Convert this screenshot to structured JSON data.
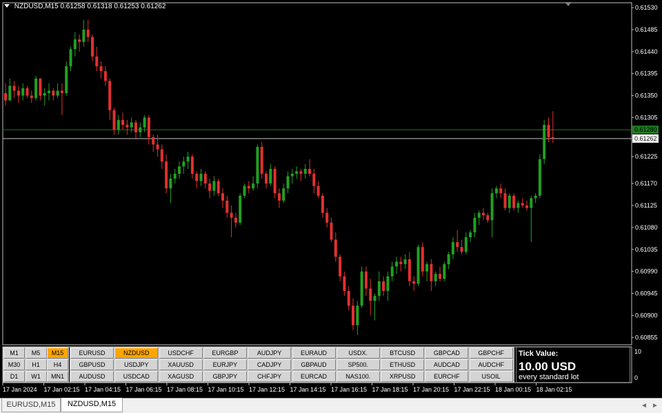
{
  "title": {
    "symbol_tf": "NZDUSD,M15",
    "ohlc": "0.61258 0.61318 0.61253 0.61262"
  },
  "colors": {
    "background": "#000000",
    "bull": "#22a022",
    "bear": "#e23030",
    "axis_text": "#ffffff",
    "ask_line": "#1f7a1f",
    "bid_line": "#c8c8c8",
    "active_button": "#ffa500"
  },
  "price_axis": {
    "labels": [
      "0.61530",
      "0.61485",
      "0.61440",
      "0.61395",
      "0.61350",
      "0.61305",
      "0.61262",
      "0.61225",
      "0.61170",
      "0.61125",
      "0.61080",
      "0.61035",
      "0.60990",
      "0.60945",
      "0.60900",
      "0.60855"
    ],
    "ask_price": "0.61280",
    "bid_price": "0.61262",
    "ylim": [
      0.6084,
      0.6154
    ]
  },
  "time_axis": {
    "labels": [
      "17 Jan 2024",
      "17 Jan 02:15",
      "17 Jan 04:15",
      "17 Jan 06:15",
      "17 Jan 08:15",
      "17 Jan 10:15",
      "17 Jan 12:15",
      "17 Jan 14:15",
      "17 Jan 16:15",
      "17 Jan 18:15",
      "17 Jan 20:15",
      "17 Jan 22:15",
      "18 Jan 00:15",
      "18 Jan 02:15"
    ]
  },
  "chart_data": {
    "type": "candlestick",
    "symbol": "NZDUSD",
    "timeframe": "M15",
    "ylim": [
      0.6084,
      0.6154
    ],
    "candles": [
      [
        0.61355,
        0.61375,
        0.6133,
        0.6134
      ],
      [
        0.6134,
        0.61385,
        0.6134,
        0.6137
      ],
      [
        0.6137,
        0.6138,
        0.61345,
        0.6136
      ],
      [
        0.6136,
        0.6137,
        0.61335,
        0.6135
      ],
      [
        0.6135,
        0.61375,
        0.6134,
        0.61365
      ],
      [
        0.61365,
        0.6137,
        0.61345,
        0.6135
      ],
      [
        0.6135,
        0.6136,
        0.61335,
        0.61345
      ],
      [
        0.61345,
        0.6139,
        0.6134,
        0.61385
      ],
      [
        0.61385,
        0.61385,
        0.6134,
        0.6135
      ],
      [
        0.6135,
        0.61365,
        0.6133,
        0.61355
      ],
      [
        0.61355,
        0.61375,
        0.6134,
        0.6136
      ],
      [
        0.6136,
        0.61365,
        0.6134,
        0.6135
      ],
      [
        0.6135,
        0.61375,
        0.61345,
        0.6136
      ],
      [
        0.6136,
        0.61375,
        0.6131,
        0.61355
      ],
      [
        0.61355,
        0.6142,
        0.6135,
        0.6141
      ],
      [
        0.6141,
        0.6145,
        0.614,
        0.61445
      ],
      [
        0.61445,
        0.6148,
        0.6143,
        0.61465
      ],
      [
        0.61465,
        0.61475,
        0.6144,
        0.6146
      ],
      [
        0.6146,
        0.61505,
        0.6145,
        0.61485
      ],
      [
        0.61485,
        0.61505,
        0.6146,
        0.6147
      ],
      [
        0.6147,
        0.61475,
        0.6142,
        0.6143
      ],
      [
        0.6143,
        0.6145,
        0.614,
        0.6141
      ],
      [
        0.6141,
        0.6142,
        0.61385,
        0.614
      ],
      [
        0.614,
        0.6141,
        0.6137,
        0.6138
      ],
      [
        0.6138,
        0.61385,
        0.613,
        0.6132
      ],
      [
        0.6132,
        0.61325,
        0.6127,
        0.6128
      ],
      [
        0.6128,
        0.6131,
        0.6127,
        0.613
      ],
      [
        0.613,
        0.61315,
        0.6128,
        0.6129
      ],
      [
        0.6129,
        0.613,
        0.6127,
        0.61285
      ],
      [
        0.61285,
        0.61305,
        0.61275,
        0.61295
      ],
      [
        0.61295,
        0.613,
        0.6126,
        0.61275
      ],
      [
        0.61275,
        0.61295,
        0.61265,
        0.61285
      ],
      [
        0.61285,
        0.6131,
        0.61275,
        0.61305
      ],
      [
        0.61305,
        0.6131,
        0.6125,
        0.61265
      ],
      [
        0.61265,
        0.6127,
        0.61235,
        0.6125
      ],
      [
        0.6125,
        0.6127,
        0.61225,
        0.6124
      ],
      [
        0.6124,
        0.6125,
        0.612,
        0.61215
      ],
      [
        0.61215,
        0.6123,
        0.6115,
        0.6116
      ],
      [
        0.6116,
        0.6119,
        0.6113,
        0.6118
      ],
      [
        0.6118,
        0.612,
        0.6117,
        0.6119
      ],
      [
        0.6119,
        0.61215,
        0.6118,
        0.61205
      ],
      [
        0.61205,
        0.61225,
        0.6119,
        0.61215
      ],
      [
        0.61215,
        0.61235,
        0.612,
        0.61225
      ],
      [
        0.61225,
        0.6123,
        0.6118,
        0.6119
      ],
      [
        0.6119,
        0.61195,
        0.6116,
        0.61175
      ],
      [
        0.61175,
        0.612,
        0.61165,
        0.6119
      ],
      [
        0.6119,
        0.61195,
        0.6116,
        0.6117
      ],
      [
        0.6117,
        0.6118,
        0.6114,
        0.61155
      ],
      [
        0.61155,
        0.61185,
        0.61145,
        0.61175
      ],
      [
        0.61175,
        0.6118,
        0.61145,
        0.6115
      ],
      [
        0.6115,
        0.6116,
        0.6112,
        0.61135
      ],
      [
        0.61135,
        0.61145,
        0.611,
        0.6111
      ],
      [
        0.6111,
        0.61125,
        0.6106,
        0.611
      ],
      [
        0.611,
        0.6111,
        0.6108,
        0.6109
      ],
      [
        0.6109,
        0.6115,
        0.61085,
        0.61145
      ],
      [
        0.61145,
        0.6117,
        0.6114,
        0.61165
      ],
      [
        0.61165,
        0.61175,
        0.6115,
        0.6116
      ],
      [
        0.6116,
        0.61185,
        0.61155,
        0.6117
      ],
      [
        0.6117,
        0.6125,
        0.6116,
        0.61245
      ],
      [
        0.61245,
        0.61255,
        0.6118,
        0.6119
      ],
      [
        0.6119,
        0.61195,
        0.6116,
        0.6117
      ],
      [
        0.6117,
        0.6121,
        0.61165,
        0.612
      ],
      [
        0.612,
        0.61205,
        0.6114,
        0.6115
      ],
      [
        0.6115,
        0.6116,
        0.6112,
        0.61135
      ],
      [
        0.61135,
        0.6117,
        0.6113,
        0.6116
      ],
      [
        0.6116,
        0.61195,
        0.6115,
        0.61185
      ],
      [
        0.61185,
        0.612,
        0.6117,
        0.6119
      ],
      [
        0.6119,
        0.61205,
        0.6118,
        0.61195
      ],
      [
        0.61195,
        0.612,
        0.61175,
        0.6119
      ],
      [
        0.6119,
        0.6121,
        0.6118,
        0.612
      ],
      [
        0.612,
        0.6122,
        0.61185,
        0.6119
      ],
      [
        0.6119,
        0.612,
        0.6115,
        0.61165
      ],
      [
        0.61165,
        0.61175,
        0.6114,
        0.61145
      ],
      [
        0.61145,
        0.6115,
        0.611,
        0.6111
      ],
      [
        0.6111,
        0.6112,
        0.6108,
        0.6109
      ],
      [
        0.6109,
        0.611,
        0.6105,
        0.61055
      ],
      [
        0.61055,
        0.6107,
        0.6101,
        0.6102
      ],
      [
        0.6102,
        0.61025,
        0.6097,
        0.6098
      ],
      [
        0.6098,
        0.6099,
        0.6094,
        0.6095
      ],
      [
        0.6095,
        0.6096,
        0.6091,
        0.6092
      ],
      [
        0.6092,
        0.60935,
        0.6087,
        0.6088
      ],
      [
        0.6088,
        0.6093,
        0.6086,
        0.6092
      ],
      [
        0.6092,
        0.61,
        0.60915,
        0.6099
      ],
      [
        0.6099,
        0.61,
        0.6094,
        0.60955
      ],
      [
        0.60955,
        0.60975,
        0.609,
        0.6093
      ],
      [
        0.6093,
        0.60945,
        0.6089,
        0.6094
      ],
      [
        0.6094,
        0.6099,
        0.6093,
        0.6097
      ],
      [
        0.6097,
        0.6098,
        0.6094,
        0.6095
      ],
      [
        0.6095,
        0.6099,
        0.6093,
        0.6098
      ],
      [
        0.6098,
        0.6101,
        0.6097,
        0.61
      ],
      [
        0.61,
        0.6102,
        0.60985,
        0.6101
      ],
      [
        0.6101,
        0.6102,
        0.6099,
        0.61005
      ],
      [
        0.61005,
        0.61025,
        0.60995,
        0.61015
      ],
      [
        0.61015,
        0.6103,
        0.6096,
        0.6097
      ],
      [
        0.6097,
        0.6098,
        0.6095,
        0.60965
      ],
      [
        0.60965,
        0.61045,
        0.6096,
        0.6104
      ],
      [
        0.6104,
        0.6105,
        0.6098,
        0.6099
      ],
      [
        0.6099,
        0.6101,
        0.6097,
        0.61005
      ],
      [
        0.61005,
        0.61015,
        0.6095,
        0.6097
      ],
      [
        0.6097,
        0.6099,
        0.6096,
        0.60985
      ],
      [
        0.60985,
        0.61,
        0.6097,
        0.60975
      ],
      [
        0.60975,
        0.6101,
        0.6097,
        0.61005
      ],
      [
        0.61005,
        0.6103,
        0.60995,
        0.61025
      ],
      [
        0.61025,
        0.6106,
        0.61015,
        0.6105
      ],
      [
        0.6105,
        0.61075,
        0.6103,
        0.6104
      ],
      [
        0.6104,
        0.61055,
        0.61025,
        0.6103
      ],
      [
        0.6103,
        0.6107,
        0.61025,
        0.6106
      ],
      [
        0.6106,
        0.61075,
        0.6105,
        0.6107
      ],
      [
        0.6107,
        0.6111,
        0.6106,
        0.611
      ],
      [
        0.611,
        0.61115,
        0.61085,
        0.6111
      ],
      [
        0.6111,
        0.6112,
        0.61095,
        0.61105
      ],
      [
        0.61105,
        0.6111,
        0.6109,
        0.61095
      ],
      [
        0.61095,
        0.6116,
        0.6106,
        0.6115
      ],
      [
        0.6115,
        0.61165,
        0.6114,
        0.6116
      ],
      [
        0.6116,
        0.6117,
        0.6114,
        0.6115
      ],
      [
        0.6115,
        0.6116,
        0.61115,
        0.6112
      ],
      [
        0.6112,
        0.6115,
        0.6111,
        0.61145
      ],
      [
        0.61145,
        0.6115,
        0.61115,
        0.6112
      ],
      [
        0.6112,
        0.61135,
        0.6111,
        0.6113
      ],
      [
        0.6113,
        0.6114,
        0.6112,
        0.61125
      ],
      [
        0.61125,
        0.61135,
        0.61115,
        0.6112
      ],
      [
        0.6112,
        0.61145,
        0.6105,
        0.6114
      ],
      [
        0.6114,
        0.6115,
        0.6113,
        0.61145
      ],
      [
        0.61145,
        0.6123,
        0.6114,
        0.6122
      ],
      [
        0.6122,
        0.613,
        0.6121,
        0.6129
      ],
      [
        0.6129,
        0.61305,
        0.61255,
        0.61265
      ],
      [
        0.61265,
        0.61318,
        0.61253,
        0.61262
      ]
    ]
  },
  "timeframes": [
    [
      "M1",
      "M5",
      "M15"
    ],
    [
      "M30",
      "H1",
      "H4"
    ],
    [
      "D1",
      "W1",
      "MN1"
    ]
  ],
  "active_timeframe": "M15",
  "symbols": [
    [
      "EURUSD",
      "NZDUSD",
      "USDCHF",
      "EURGBP",
      "AUDJPY",
      "EURAUD",
      "USDX.",
      "BTCUSD",
      "GBPCAD",
      "GBPCHF"
    ],
    [
      "GBPUSD",
      "USDJPY",
      "XAUUSD",
      "EURJPY",
      "CADJPY",
      "GBPAUD",
      "SP500.",
      "ETHUSD",
      "AUDCAD",
      "AUDCHF"
    ],
    [
      "AUDUSD",
      "USDCAD",
      "XAGUSD",
      "GBPJPY",
      "CHFJPY",
      "EURCAD",
      "NAS100.",
      "XRPUSD",
      "EURCHF",
      "USOIL"
    ]
  ],
  "active_symbol": "NZDUSD",
  "tick": {
    "title": "Tick Value:",
    "value": "10.00 USD",
    "sub": "every standard lot"
  },
  "sub_axis": {
    "top": "10",
    "bottom": "0"
  },
  "tabs": [
    {
      "label": "EURUSD,M15",
      "active": false
    },
    {
      "label": "NZDUSD,M15",
      "active": true
    }
  ],
  "scroll": {
    "left": "◄",
    "right": "►"
  }
}
